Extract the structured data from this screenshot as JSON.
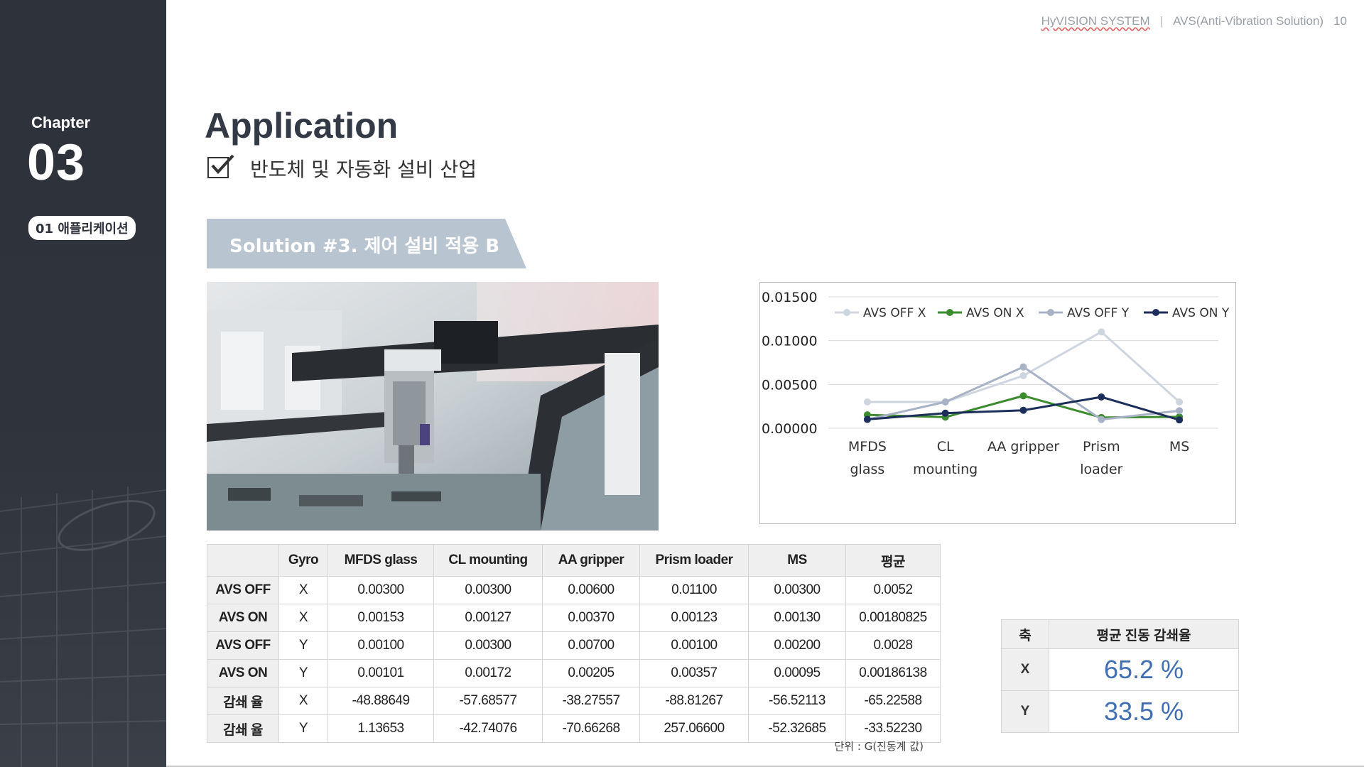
{
  "sidebar": {
    "chapter_label": "Chapter",
    "chapter_number": "03",
    "section_pill": "01 애플리케이션"
  },
  "header": {
    "brand": "HyVISION SYSTEM",
    "separator": "|",
    "doc_title": "AVS(Anti-Vibration Solution)",
    "page_number": "10"
  },
  "main": {
    "title": "Application",
    "subtitle": "반도체 및 자동화 설비 산업",
    "banner": "Solution #3. 제어 설비 적용 B"
  },
  "chart_data": {
    "type": "line",
    "categories": [
      "MFDS glass",
      "CL mounting",
      "AA gripper",
      "Prism loader",
      "MS"
    ],
    "category_lines": [
      [
        "MFDS",
        "glass"
      ],
      [
        "CL",
        "mounting"
      ],
      [
        "AA gripper"
      ],
      [
        "Prism",
        "loader"
      ],
      [
        "MS"
      ]
    ],
    "series": [
      {
        "name": "AVS OFF X",
        "color": "#cfd5df",
        "values": [
          0.003,
          0.003,
          0.006,
          0.011,
          0.003
        ]
      },
      {
        "name": "AVS ON X",
        "color": "#3d8b2f",
        "values": [
          0.00153,
          0.00127,
          0.0037,
          0.00123,
          0.0013
        ]
      },
      {
        "name": "AVS OFF Y",
        "color": "#a7b2c5",
        "values": [
          0.001,
          0.003,
          0.007,
          0.001,
          0.002
        ]
      },
      {
        "name": "AVS ON Y",
        "color": "#1c2f5a",
        "values": [
          0.00101,
          0.00172,
          0.00205,
          0.00357,
          0.00095
        ]
      }
    ],
    "yticks": [
      "0.00000",
      "0.00500",
      "0.01000",
      "0.01500"
    ],
    "ylim": [
      0,
      0.015
    ],
    "grid": true,
    "legend": "top"
  },
  "table": {
    "headers": [
      "",
      "Gyro",
      "MFDS glass",
      "CL mounting",
      "AA gripper",
      "Prism loader",
      "MS",
      "평균"
    ],
    "rows": [
      [
        "AVS OFF",
        "X",
        "0.00300",
        "0.00300",
        "0.00600",
        "0.01100",
        "0.00300",
        "0.0052"
      ],
      [
        "AVS ON",
        "X",
        "0.00153",
        "0.00127",
        "0.00370",
        "0.00123",
        "0.00130",
        "0.00180825"
      ],
      [
        "AVS OFF",
        "Y",
        "0.00100",
        "0.00300",
        "0.00700",
        "0.00100",
        "0.00200",
        "0.0028"
      ],
      [
        "AVS ON",
        "Y",
        "0.00101",
        "0.00172",
        "0.00205",
        "0.00357",
        "0.00095",
        "0.00186138"
      ],
      [
        "감쇄 율",
        "X",
        "-48.88649",
        "-57.68577",
        "-38.27557",
        "-88.81267",
        "-56.52113",
        "-65.22588"
      ],
      [
        "감쇄 율",
        "Y",
        "1.13653",
        "-42.74076",
        "-70.66268",
        "257.06600",
        "-52.32685",
        "-33.52230"
      ]
    ],
    "unit_note": "단위 : G(진동계 값)"
  },
  "reduction": {
    "headers": [
      "축",
      "평균 진동 감쇄율"
    ],
    "rows": [
      {
        "axis": "X",
        "value": "65.2 %"
      },
      {
        "axis": "Y",
        "value": "33.5 %"
      }
    ]
  }
}
